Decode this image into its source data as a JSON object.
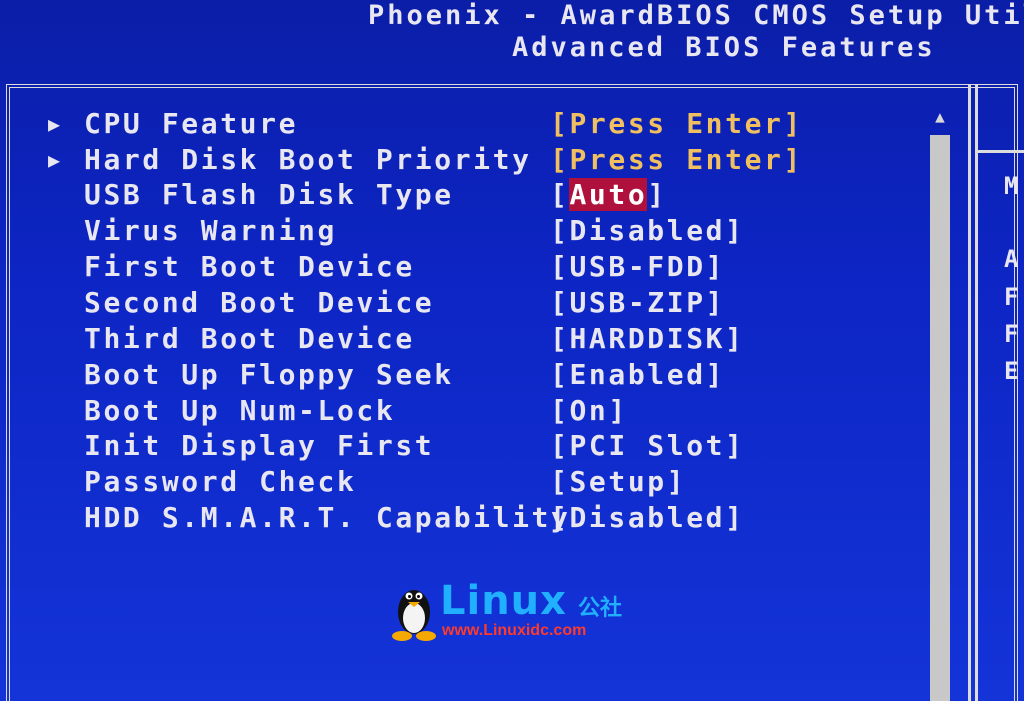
{
  "header": {
    "title": "Phoenix - AwardBIOS CMOS Setup Utili",
    "subtitle": "Advanced BIOS Features"
  },
  "menu": [
    {
      "label": "CPU Feature",
      "value": "[Press Enter]",
      "submenu": true
    },
    {
      "label": "Hard Disk Boot Priority",
      "value": "[Press Enter]",
      "submenu": true
    },
    {
      "label": "USB Flash Disk Type",
      "value_open": "[",
      "value_selected": "Auto",
      "value_close": "]",
      "selected": true
    },
    {
      "label": "Virus Warning",
      "value": "[Disabled]"
    },
    {
      "label": "First Boot Device",
      "value": "[USB-FDD]"
    },
    {
      "label": "Second Boot Device",
      "value": "[USB-ZIP]"
    },
    {
      "label": "Third Boot Device",
      "value": "[HARDDISK]"
    },
    {
      "label": "Boot Up Floppy Seek",
      "value": "[Enabled]"
    },
    {
      "label": "Boot Up Num-Lock",
      "value": "[On]"
    },
    {
      "label": "Init Display First",
      "value": "[PCI Slot]"
    },
    {
      "label": "Password Check",
      "value": "[Setup]"
    },
    {
      "label": "HDD S.M.A.R.T. Capability",
      "value": "[Disabled]"
    }
  ],
  "help_panel": {
    "lines": [
      "M",
      "A",
      "F",
      "F",
      "E"
    ]
  },
  "watermark": {
    "brand": "Linux",
    "brand_cn": "公社",
    "url": "www.Linuxidc.com"
  },
  "colors": {
    "background": "#0d25c4",
    "text": "#e8e6f0",
    "submenu_value": "#f0c060",
    "highlight": "#b0103c"
  }
}
